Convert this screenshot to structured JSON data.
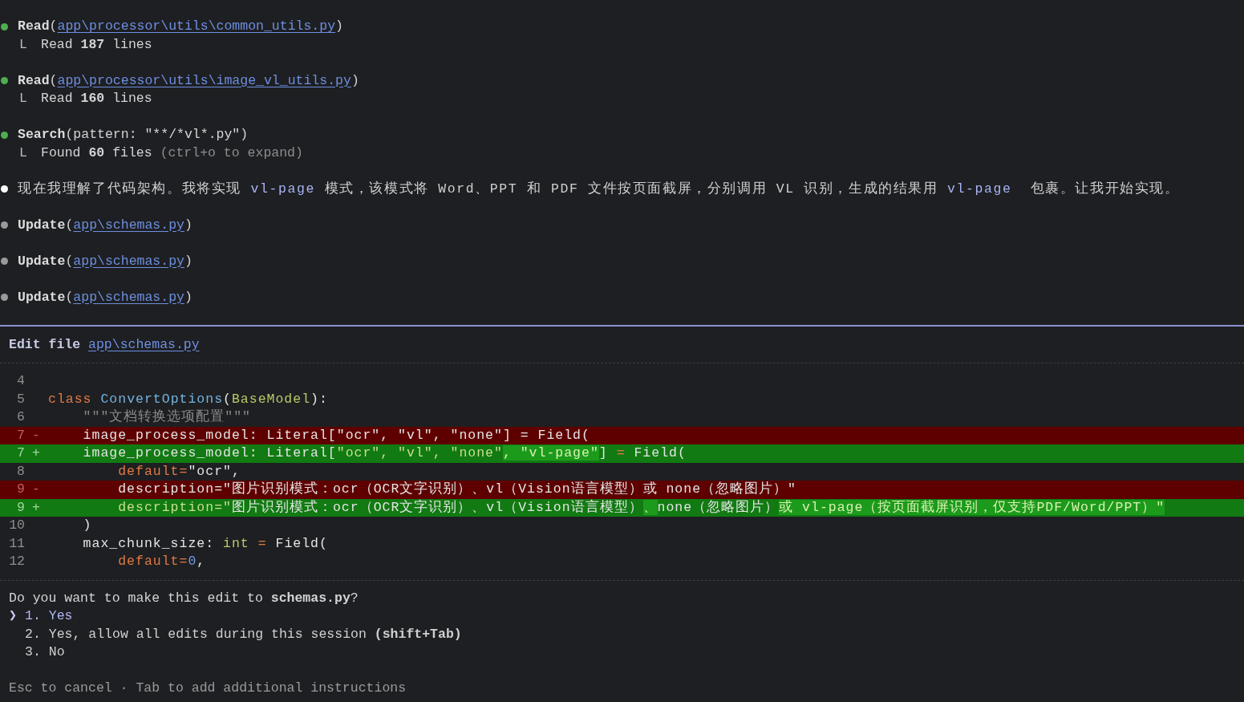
{
  "log": [
    {
      "kind": "tool",
      "color": "#4caf50",
      "name": "Read",
      "open": "(",
      "target": "app\\processor\\utils\\common_utils.py",
      "close": ")",
      "branch": "L",
      "result": "Read **187** lines"
    },
    {
      "kind": "tool",
      "color": "#4caf50",
      "name": "Read",
      "open": "(",
      "target": "app\\processor\\utils\\image_vl_utils.py",
      "close": ")",
      "branch": "L",
      "result": "Read **160** lines"
    },
    {
      "kind": "tool",
      "color": "#4caf50",
      "name": "Search",
      "args": "(pattern: \"**/*vl*.py\")",
      "branch": "L",
      "result": "Found **60** files",
      "hint": "(ctrl+o to expand)"
    },
    {
      "kind": "message",
      "color": "#ffffff",
      "segments": [
        {
          "t": "现在我理解了代码架构。我将实现 ",
          "kind": "text"
        },
        {
          "t": "vl-page",
          "kind": "code"
        },
        {
          "t": " 模式，该模式将 Word、PPT 和 PDF 文件按页面截屏，分别调用 VL 识别，生成的结果用 ",
          "kind": "text"
        },
        {
          "t": "vl-page",
          "kind": "code"
        },
        {
          "t": "  包裹。让我开始实现。",
          "kind": "text"
        }
      ]
    },
    {
      "kind": "tool",
      "color": "#9a9a9a",
      "name": "Update",
      "open": "(",
      "target": "app\\schemas.py",
      "close": ")"
    },
    {
      "kind": "tool",
      "color": "#9a9a9a",
      "name": "Update",
      "open": "(",
      "target": "app\\schemas.py",
      "close": ")"
    },
    {
      "kind": "tool",
      "color": "#9a9a9a",
      "name": "Update",
      "open": "(",
      "target": "app\\schemas.py",
      "close": ")"
    }
  ],
  "edit": {
    "label": "Edit file",
    "target": "app\\schemas.py",
    "lines": [
      {
        "number": "4",
        "kind": "context"
      },
      {
        "number": "5",
        "kind": "context",
        "segments": [
          {
            "t": "class ",
            "kind": "keyword"
          },
          {
            "t": "ConvertOptions",
            "kind": "type"
          },
          {
            "t": "(",
            "kind": "plain"
          },
          {
            "t": "BaseModel",
            "kind": "base"
          },
          {
            "t": "):",
            "kind": "plain"
          }
        ]
      },
      {
        "number": "6",
        "kind": "context",
        "segments": [
          {
            "t": "    \"\"\"文档转换选项配置\"\"\"",
            "kind": "comment"
          }
        ]
      },
      {
        "number": "7",
        "sign": "-",
        "kind": "removed",
        "segments": [
          {
            "t": "    image_process_model: Literal[\"ocr\", \"vl\", \"none\"] = Field(",
            "kind": "plain"
          }
        ]
      },
      {
        "number": "7",
        "sign": "+",
        "kind": "added",
        "segments": [
          {
            "t": "    image_process_model: Literal[",
            "kind": "plain"
          },
          {
            "t": "\"ocr\", \"vl\", \"none\"",
            "kind": "added"
          },
          {
            "t": ", \"vl-page\"",
            "kind": "hl"
          },
          {
            "t": "] ",
            "kind": "plain"
          },
          {
            "t": "=",
            "kind": "keyword"
          },
          {
            "t": " Field(",
            "kind": "plain"
          }
        ]
      },
      {
        "number": "8",
        "kind": "context",
        "segments": [
          {
            "t": "        default=",
            "kind": "keyword"
          },
          {
            "t": "\"ocr\",",
            "kind": "plain"
          }
        ]
      },
      {
        "number": "9",
        "sign": "-",
        "kind": "removed",
        "segments": [
          {
            "t": "        description=\"图片识别模式：ocr（OCR文字识别）、vl（Vision语言模型）或 none（忽略图片）\"",
            "kind": "plain"
          }
        ]
      },
      {
        "number": "9",
        "sign": "+",
        "kind": "added",
        "segments": [
          {
            "t": "        description=\"",
            "kind": "added"
          },
          {
            "t": "图片识别模式：ocr（OCR文字识别）、vl（Vision语言模型）",
            "kind": "plain"
          },
          {
            "t": "、",
            "kind": "hl"
          },
          {
            "t": "none（忽略图片）",
            "kind": "plain"
          },
          {
            "t": "或 vl-page（按页面截屏识别，仅支持PDF/Word/PPT）\"",
            "kind": "hl"
          }
        ]
      },
      {
        "number": "10",
        "kind": "context",
        "segments": [
          {
            "t": "    )",
            "kind": "plain"
          }
        ]
      },
      {
        "number": "11",
        "kind": "context",
        "segments": [
          {
            "t": "    max_chunk_size: ",
            "kind": "plain"
          },
          {
            "t": "int",
            "kind": "base"
          },
          {
            "t": " = ",
            "kind": "keyword"
          },
          {
            "t": "Field(",
            "kind": "plain"
          }
        ]
      },
      {
        "number": "12",
        "kind": "context",
        "segments": [
          {
            "t": "        default=",
            "kind": "keyword"
          },
          {
            "t": "0",
            "kind": "number"
          },
          {
            "t": ",",
            "kind": "plain"
          }
        ]
      }
    ]
  },
  "prompt": {
    "question": "Do you want to make this edit to **schemas.py**?",
    "pointer": "❯",
    "options": [
      {
        "number": "1.",
        "label": "Yes",
        "selected": true
      },
      {
        "number": "2.",
        "label": "Yes, allow all edits during this session **(shift+Tab)**",
        "selected": false
      },
      {
        "number": "3.",
        "label": "No",
        "selected": false
      }
    ]
  },
  "footer": "Esc to cancel · Tab to add additional instructions"
}
